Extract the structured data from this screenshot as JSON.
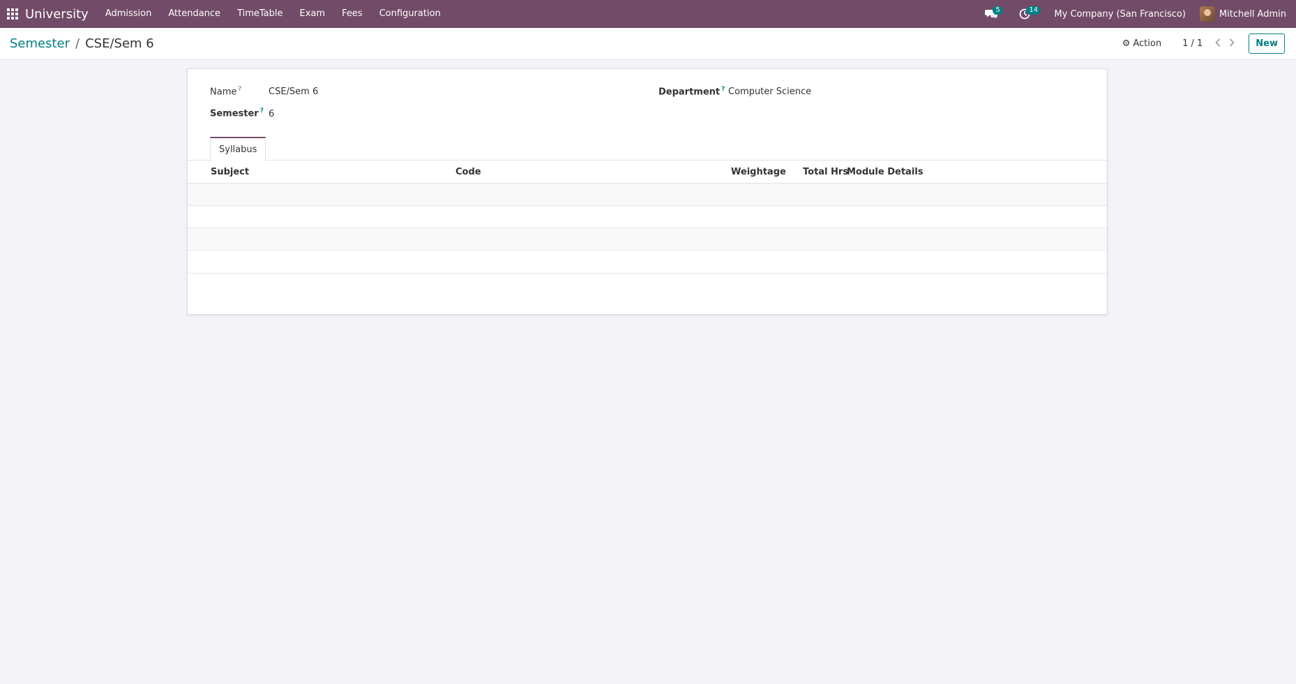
{
  "navbar": {
    "brand": "University",
    "menu": [
      "Admission",
      "Attendance",
      "TimeTable",
      "Exam",
      "Fees",
      "Configuration"
    ],
    "messages_count": "5",
    "activities_count": "14",
    "company": "My Company (San Francisco)",
    "user": "Mitchell Admin",
    "colors": {
      "background": "#714b67",
      "badge": "#017e84"
    }
  },
  "control": {
    "breadcrumb_parent": "Semester",
    "breadcrumb_separator": "/",
    "breadcrumb_current": "CSE/Sem 6",
    "action_label": "Action",
    "pager": "1 / 1",
    "new_label": "New"
  },
  "form": {
    "name_label": "Name",
    "name_value": "CSE/Sem 6",
    "semester_label": "Semester",
    "semester_value": "6",
    "department_label": "Department",
    "department_value": "Computer Science",
    "help_marker": "?"
  },
  "tabs": [
    {
      "label": "Syllabus"
    }
  ],
  "table": {
    "columns": [
      "Subject",
      "Code",
      "Weightage",
      "Total Hrs",
      "Module Details"
    ],
    "rows": []
  }
}
